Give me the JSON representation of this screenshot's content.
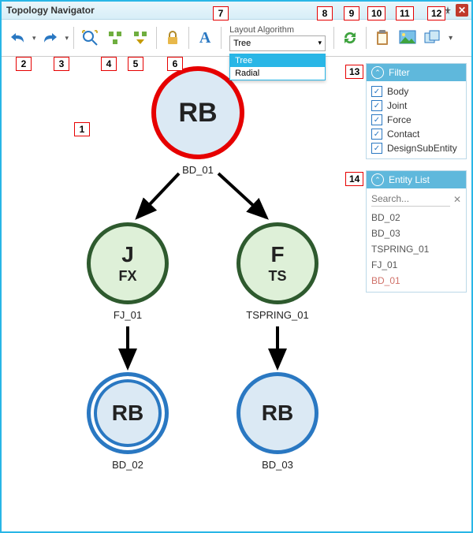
{
  "window": {
    "title": "Topology Navigator"
  },
  "toolbar": {
    "undo": "undo-icon",
    "redo": "redo-icon",
    "zoom_fit": "zoom-fit-icon",
    "arrange": "arrange-icon",
    "collapse": "collapse-icon",
    "lock": "lock-icon",
    "font": "font-icon",
    "refresh": "refresh-icon",
    "paste": "clipboard-icon",
    "image": "image-icon",
    "layout_views": "views-icon"
  },
  "layout": {
    "label": "Layout Algorithm",
    "selected": "Tree",
    "options": [
      "Tree",
      "Radial"
    ]
  },
  "callouts": {
    "1": "1",
    "2": "2",
    "3": "3",
    "4": "4",
    "5": "5",
    "6": "6",
    "7": "7",
    "8": "8",
    "9": "9",
    "10": "10",
    "11": "11",
    "12": "12",
    "13": "13",
    "14": "14"
  },
  "graph": {
    "root": {
      "line1": "RB",
      "label": "BD_01"
    },
    "mid_l": {
      "line1": "J",
      "line2": "FX",
      "label": "FJ_01"
    },
    "mid_r": {
      "line1": "F",
      "line2": "TS",
      "label": "TSPRING_01"
    },
    "leaf_l": {
      "line1": "RB",
      "label": "BD_02"
    },
    "leaf_r": {
      "line1": "RB",
      "label": "BD_03"
    }
  },
  "filter": {
    "title": "Filter",
    "items": [
      "Body",
      "Joint",
      "Force",
      "Contact",
      "DesignSubEntity"
    ]
  },
  "entity_list": {
    "title": "Entity List",
    "search_placeholder": "Search...",
    "items": [
      "BD_02",
      "BD_03",
      "TSPRING_01",
      "FJ_01",
      "BD_01"
    ],
    "highlight": "BD_01"
  }
}
